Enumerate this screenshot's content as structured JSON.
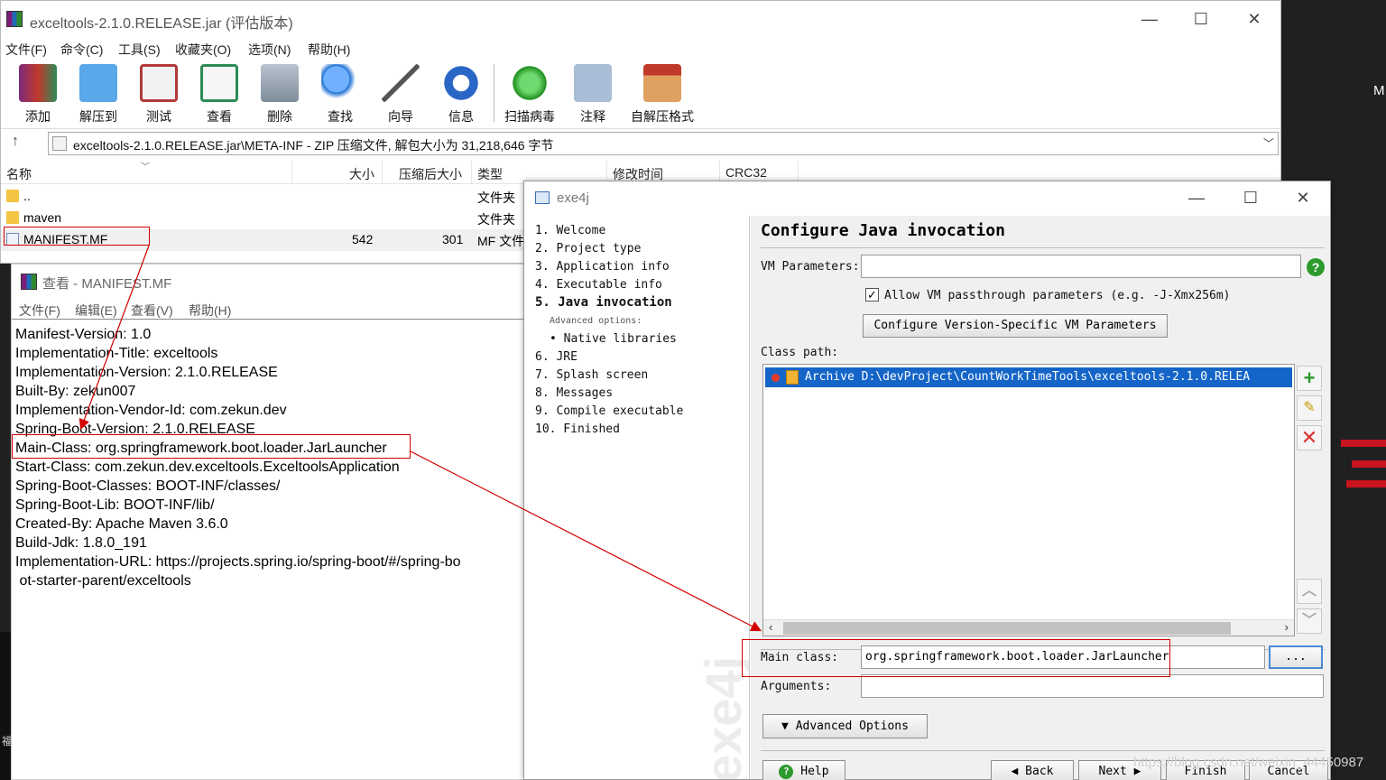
{
  "winrar": {
    "title": "exceltools-2.1.0.RELEASE.jar (评估版本)",
    "menu": [
      "文件(F)",
      "命令(C)",
      "工具(S)",
      "收藏夹(O)",
      "选项(N)",
      "帮助(H)"
    ],
    "toolbar": [
      {
        "label": "添加",
        "icon": "add-archive-icon",
        "color": "#c0392b"
      },
      {
        "label": "解压到",
        "icon": "extract-folder-icon",
        "color": "#3b8fd9"
      },
      {
        "label": "测试",
        "icon": "test-clipboard-icon",
        "color": "#b33a3a"
      },
      {
        "label": "查看",
        "icon": "view-book-icon",
        "color": "#2e8b57"
      },
      {
        "label": "删除",
        "icon": "trash-icon",
        "color": "#8a9aa8"
      },
      {
        "label": "查找",
        "icon": "magnifier-icon",
        "color": "#1d6fd1"
      },
      {
        "label": "向导",
        "icon": "magic-wand-icon",
        "color": "#6b6b6b"
      },
      {
        "label": "信息",
        "icon": "info-icon",
        "color": "#2a66c6"
      },
      {
        "label": "扫描病毒",
        "icon": "virus-scan-icon",
        "color": "#2aa02a"
      },
      {
        "label": "注释",
        "icon": "comment-icon",
        "color": "#8aa4c4"
      },
      {
        "label": "自解压格式",
        "icon": "sfx-box-icon",
        "color": "#d9772b"
      }
    ],
    "path": "exceltools-2.1.0.RELEASE.jar\\META-INF - ZIP 压缩文件, 解包大小为 31,218,646 字节",
    "columns": {
      "name": "名称",
      "size": "大小",
      "packed": "压缩后大小",
      "type": "类型",
      "modified": "修改时间",
      "crc": "CRC32"
    },
    "rows": [
      {
        "name": "..",
        "size": "",
        "packed": "",
        "type": "文件夹"
      },
      {
        "name": "maven",
        "size": "",
        "packed": "",
        "type": "文件夹"
      },
      {
        "name": "MANIFEST.MF",
        "size": "542",
        "packed": "301",
        "type": "MF 文件"
      }
    ]
  },
  "viewer": {
    "title": "查看 - MANIFEST.MF",
    "menu": [
      "文件(F)",
      "编辑(E)",
      "查看(V)",
      "帮助(H)"
    ],
    "lines": [
      "Manifest-Version: 1.0",
      "Implementation-Title: exceltools",
      "Implementation-Version: 2.1.0.RELEASE",
      "Built-By: zekun007",
      "Implementation-Vendor-Id: com.zekun.dev",
      "Spring-Boot-Version: 2.1.0.RELEASE",
      "Main-Class: org.springframework.boot.loader.JarLauncher",
      "Start-Class: com.zekun.dev.exceltools.ExceltoolsApplication",
      "Spring-Boot-Classes: BOOT-INF/classes/",
      "Spring-Boot-Lib: BOOT-INF/lib/",
      "Created-By: Apache Maven 3.6.0",
      "Build-Jdk: 1.8.0_191",
      "Implementation-URL: https://projects.spring.io/spring-boot/#/spring-bo",
      " ot-starter-parent/exceltools"
    ]
  },
  "exe4j": {
    "title": "exe4j",
    "steps": [
      "1. Welcome",
      "2. Project type",
      "3. Application info",
      "4. Executable info",
      "5. Java invocation",
      "Advanced options:",
      "• Native libraries",
      "6. JRE",
      "7. Splash screen",
      "8. Messages",
      "9. Compile executable",
      "10. Finished"
    ],
    "watermark": "exe4j",
    "page_title": "Configure Java invocation",
    "vm_params_label": "VM Parameters:",
    "vm_params_value": "",
    "allow_passthrough_label": "Allow VM passthrough parameters (e.g. -J-Xmx256m)",
    "allow_passthrough_checked": true,
    "configure_vm_button": "Configure Version-Specific VM Parameters",
    "classpath_label": "Class path:",
    "classpath_entry": "Archive D:\\devProject\\CountWorkTimeTools\\exceltools-2.1.0.RELEA",
    "main_class_label": "Main class:",
    "main_class_value": "org.springframework.boot.loader.JarLauncher",
    "browse_button": "...",
    "arguments_label": "Arguments:",
    "arguments_value": "",
    "advanced_options_button": "Advanced Options",
    "buttons": {
      "help": "Help",
      "back": "Back",
      "next": "Next",
      "finish": "Finish",
      "cancel": "Cancel"
    }
  },
  "desktop": {
    "right_char": "M",
    "left_char": "福"
  },
  "csdn_watermark": "https://blog.csdn.net/weixin_44450987",
  "colors": {
    "annotation_red": "#d20000",
    "selection_blue": "#1565c8",
    "help_green": "#2c9a2c"
  }
}
